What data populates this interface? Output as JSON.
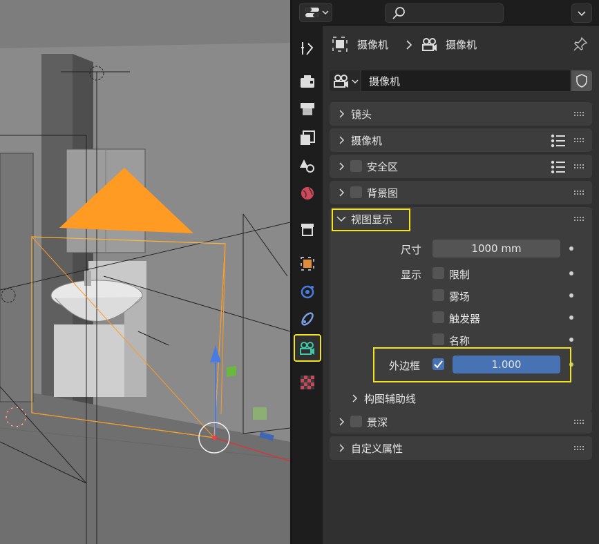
{
  "header": {
    "breadcrumb_object": "摄像机",
    "breadcrumb_data": "摄像机",
    "datablock_name": "摄像机"
  },
  "panels": {
    "lens": "镜头",
    "camera": "摄像机",
    "safe_areas": "安全区",
    "background_images": "背景图",
    "viewport_display": "视图显示",
    "depth_of_field": "景深",
    "custom_properties": "自定义属性"
  },
  "viewport_display": {
    "size_label": "尺寸",
    "size_value": "1000 mm",
    "show_label": "显示",
    "show_limits": "限制",
    "show_mist": "雾场",
    "show_sensor": "触发器",
    "show_name": "名称",
    "passepartout_label": "外边框",
    "passepartout_value": "1.000",
    "composition_guides": "构图辅助线"
  },
  "tabs": [
    "tool-icon",
    "render-icon",
    "output-icon",
    "view-layer-icon",
    "scene-icon",
    "world-icon",
    "collection-icon",
    "object-icon",
    "physics-icon",
    "constraints-icon",
    "camera-data-icon",
    "texture-icon"
  ],
  "colors": {
    "accent_blue": "#4772b3",
    "highlight_yellow": "#f5e31c",
    "camera_orange": "#ff9a22",
    "active_tab_green": "#3fc8a5"
  }
}
